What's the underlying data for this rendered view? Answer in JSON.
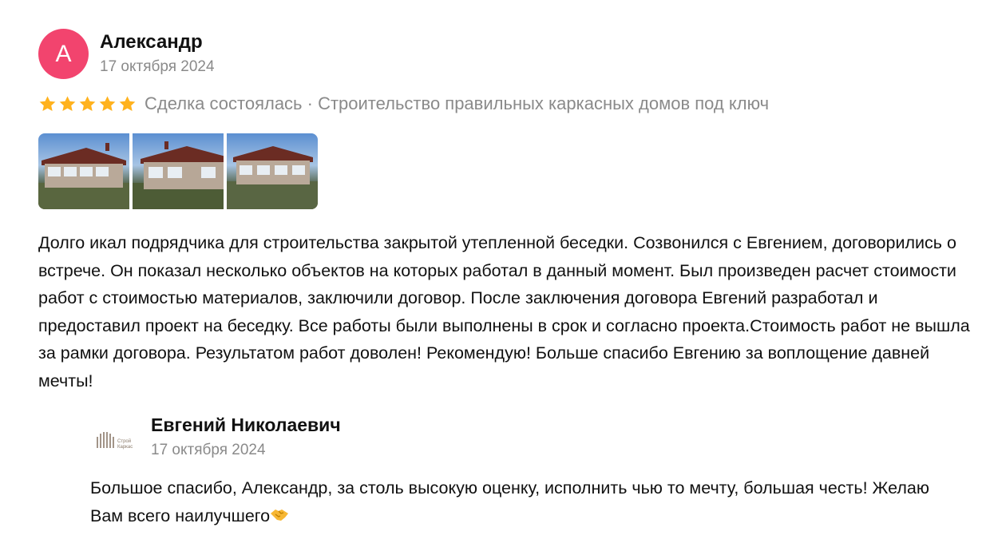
{
  "review": {
    "avatar_letter": "А",
    "avatar_color": "#f2446e",
    "author": "Александр",
    "date": "17 октября 2024",
    "rating": 5,
    "rating_max": 5,
    "star_color": "#ffb21e",
    "meta": "Сделка состоялась · Строительство правильных каркасных домов под ключ",
    "photos": [
      "photo-1",
      "photo-2",
      "photo-3"
    ],
    "text": "Долго икал подрядчика для строительства закрытой утепленной беседки. Созвонился с Евгением, договорились о встрече. Он показал несколько объектов на которых работал в данный момент. Был произведен расчет стоимости работ с стоимостью материалов, заключили договор. После заключения договора Евгений разработал и предоставил проект на беседку. Все работы были выполнены в срок и согласно проекта.Стоимость работ не вышла за рамки договора. Результатом работ доволен! Рекомендую! Больше спасибо Евгению за воплощение давней мечты!"
  },
  "reply": {
    "logo_text_line1": "Строй",
    "logo_text_line2": "Каркас",
    "author": "Евгений Николаевич",
    "date": "17 октября 2024",
    "text": "Большое спасибо, Александр, за столь высокую оценку, исполнить чью то мечту, большая честь! Желаю Вам всего наилучшего",
    "emoji": "handshake-icon"
  }
}
